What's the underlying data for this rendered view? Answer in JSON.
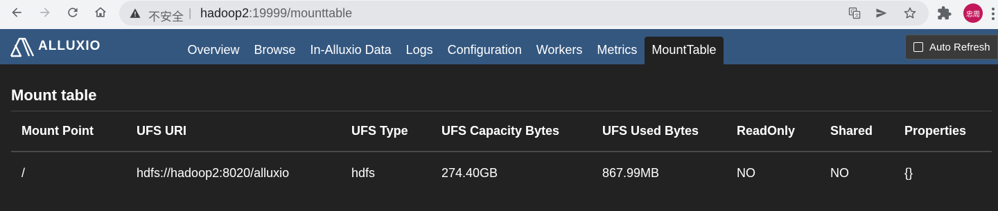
{
  "browser": {
    "insecure_label": "不安全",
    "separator": "|",
    "url_host": "hadoop2",
    "url_rest": ":19999/mounttable",
    "profile_label": "忠周"
  },
  "app": {
    "brand": "ALLUXIO",
    "tabs": [
      {
        "label": "Overview"
      },
      {
        "label": "Browse"
      },
      {
        "label": "In-Alluxio Data"
      },
      {
        "label": "Logs"
      },
      {
        "label": "Configuration"
      },
      {
        "label": "Workers"
      },
      {
        "label": "Metrics"
      },
      {
        "label": "MountTable",
        "active": true
      }
    ],
    "auto_refresh_label": "Auto Refresh"
  },
  "main": {
    "title": "Mount table",
    "columns": [
      "Mount Point",
      "UFS URI",
      "UFS Type",
      "UFS Capacity Bytes",
      "UFS Used Bytes",
      "ReadOnly",
      "Shared",
      "Properties"
    ],
    "rows": [
      [
        "/",
        "hdfs://hadoop2:8020/alluxio",
        "hdfs",
        "274.40GB",
        "867.99MB",
        "NO",
        "NO",
        "{}"
      ]
    ]
  },
  "colors": {
    "header_bg": "#34577f",
    "page_bg": "#222222",
    "chrome_bg": "#f1f3f4"
  }
}
